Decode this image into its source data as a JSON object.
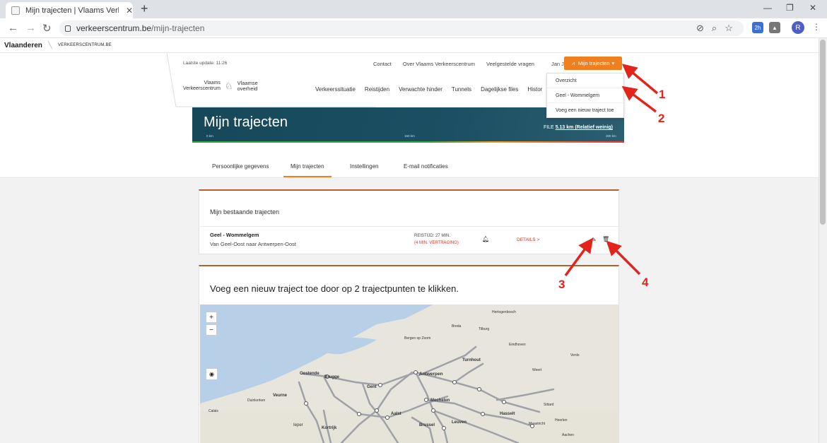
{
  "browser": {
    "tab_title": "Mijn trajecten | Vlaams Verkeerscentrum",
    "new_tab": "+",
    "url_domain": "verkeerscentrum.be",
    "url_path": "/mijn-trajecten",
    "avatar_letter": "R",
    "ext_badge": "2h"
  },
  "govbar": {
    "brand": "Vlaanderen",
    "site": "VERKEERSCENTRUM.BE"
  },
  "header": {
    "last_update": "Laatste update: 11:26",
    "top_links": [
      "Contact",
      "Over Vlaams Verkeerscentrum",
      "Veelgestelde vragen"
    ],
    "user": "Jan Jansen",
    "mijn_btn": "Mijn trajecten",
    "logo_line1": "Vlaams",
    "logo_line2": "Verkeerscentrum",
    "logo_gov1": "Vlaamse",
    "logo_gov2": "overheid",
    "main_nav": [
      "Verkeerssituatie",
      "Reistijden",
      "Verwachte hinder",
      "Tunnels",
      "Dagelijkse files",
      "Histor"
    ],
    "dropdown": [
      "Overzicht",
      "Geel - Wommelgem",
      "Voeg een nieuw traject toe"
    ]
  },
  "banner": {
    "title": "Mijn trajecten",
    "scale_0": "0 km",
    "scale_150": "150 km",
    "scale_300": "300 km",
    "file_label": "FILE",
    "file_value": "5.13 km (Relatief weinig)"
  },
  "tabs": [
    "Persoonlijke gegevens",
    "Mijn trajecten",
    "Instellingen",
    "E-mail notificaties"
  ],
  "existing": {
    "title": "Mijn bestaande trajecten",
    "route": {
      "name": "Geel - Wommelgem",
      "sub": "Van Geel-Oost naar Antwerpen-Oost",
      "time": "REISTIJD: 27 MIN.",
      "delay": "(4 MIN. VERTRAGING)",
      "details": "DETAILS >"
    }
  },
  "new_route": {
    "title": "Voeg een nieuw traject toe door op 2 trajectpunten te klikken."
  },
  "map": {
    "zoom_in": "+",
    "zoom_out": "−",
    "cities": [
      "Hertogenbosch",
      "Breda",
      "Tilburg",
      "Bergen op Zoom",
      "Eindhoven",
      "Venlo",
      "Turnhout",
      "Weert",
      "Oostende",
      "Brugge",
      "Antwerpen",
      "Mechelen",
      "Duinkerken",
      "Veurne",
      "Aalst",
      "Hasselt",
      "Sittard",
      "Calais",
      "Ieper",
      "Kortrijk",
      "Brussel",
      "Leuven",
      "Maastricht",
      "Heerlen",
      "Aachen",
      "Gent"
    ]
  },
  "annotations": [
    "1",
    "2",
    "3",
    "4"
  ],
  "colors": {
    "accent": "#f07f1e",
    "banner": "#1c4f63",
    "delay": "#c63b2a",
    "arrow": "#e2241b"
  }
}
